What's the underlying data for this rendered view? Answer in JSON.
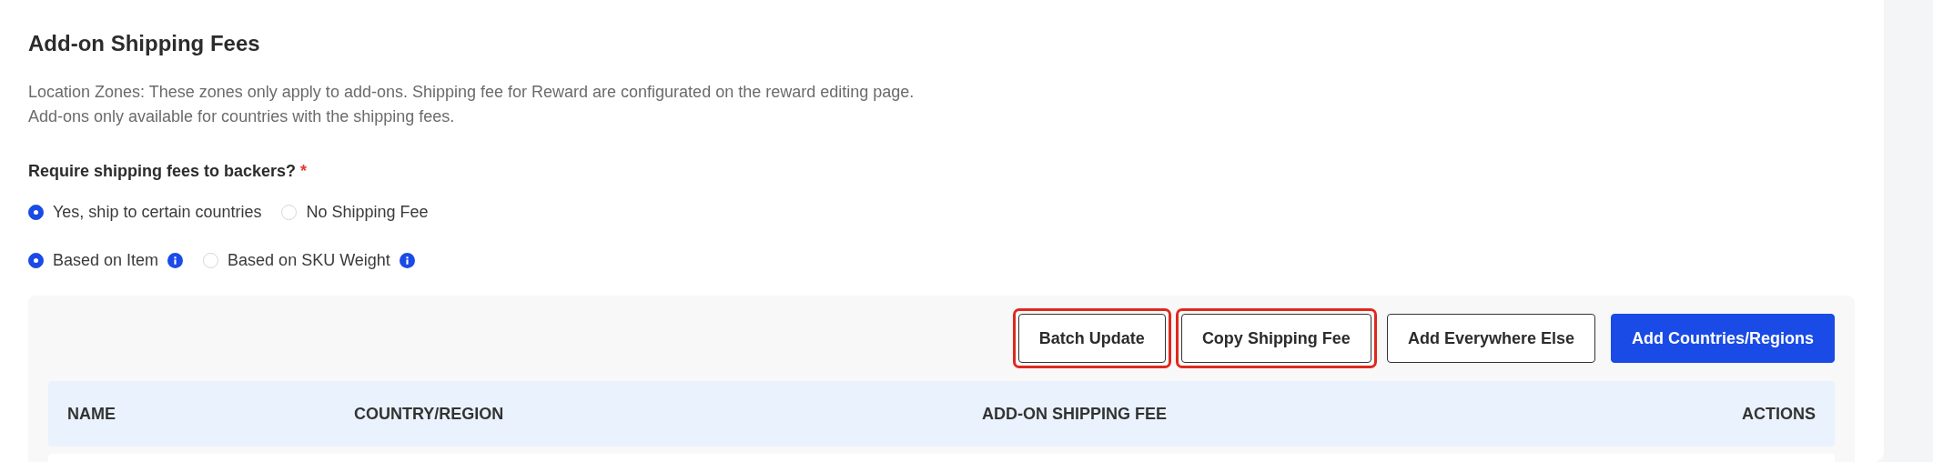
{
  "section": {
    "title": "Add-on Shipping Fees",
    "description": [
      "Location Zones: These zones only apply to add-ons. Shipping fee for Reward are configurated on the reward editing page.",
      "Add-ons only available for countries with the shipping fees."
    ]
  },
  "question": {
    "label": "Require shipping fees to backers?",
    "required_mark": "*"
  },
  "radio_groups": [
    {
      "options": [
        {
          "label": "Yes, ship to certain countries",
          "selected": true,
          "info": false
        },
        {
          "label": "No Shipping Fee",
          "selected": false,
          "info": false
        }
      ]
    },
    {
      "options": [
        {
          "label": "Based on Item",
          "selected": true,
          "info": true
        },
        {
          "label": "Based on SKU Weight",
          "selected": false,
          "info": true
        }
      ]
    }
  ],
  "toolbar": {
    "buttons": [
      {
        "label": "Batch Update",
        "kind": "outline",
        "highlighted": true
      },
      {
        "label": "Copy Shipping Fee",
        "kind": "outline",
        "highlighted": true
      },
      {
        "label": "Add Everywhere Else",
        "kind": "outline",
        "highlighted": false
      },
      {
        "label": "Add Countries/Regions",
        "kind": "primary",
        "highlighted": false
      }
    ]
  },
  "table": {
    "columns": [
      "NAME",
      "COUNTRY/REGION",
      "ADD-ON SHIPPING FEE",
      "ACTIONS"
    ]
  }
}
